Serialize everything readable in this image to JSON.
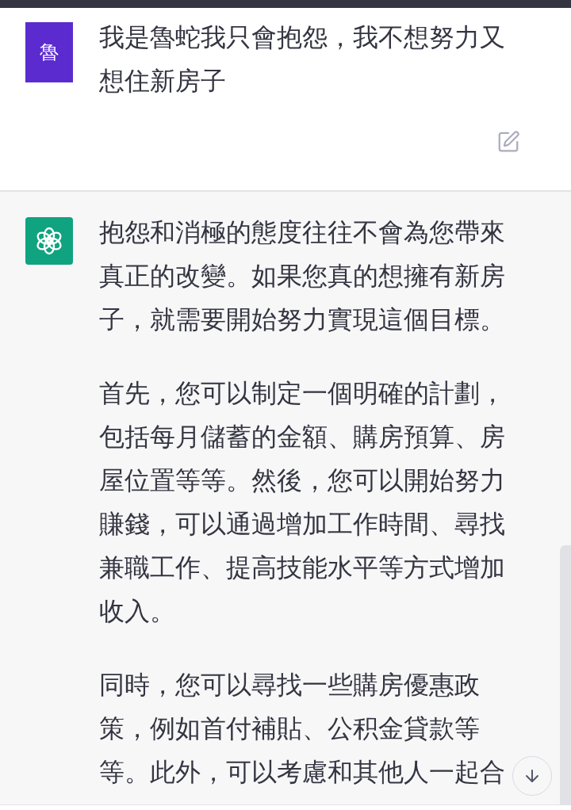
{
  "user_message": {
    "avatar_text": "魯",
    "text": "我是魯蛇我只會抱怨，我不想努力又想住新房子"
  },
  "assistant_message": {
    "paragraphs": [
      "抱怨和消極的態度往往不會為您帶來真正的改變。如果您真的想擁有新房子，就需要開始努力實現這個目標。",
      "首先，您可以制定一個明確的計劃，包括每月儲蓄的金額、購房預算、房屋位置等等。然後，您可以開始努力賺錢，可以通過增加工作時間、尋找兼職工作、提高技能水平等方式增加收入。",
      "同時，您可以尋找一些購房優惠政策，例如首付補貼、公积金貸款等等。此外，可以考慮和其他人一起合"
    ]
  }
}
